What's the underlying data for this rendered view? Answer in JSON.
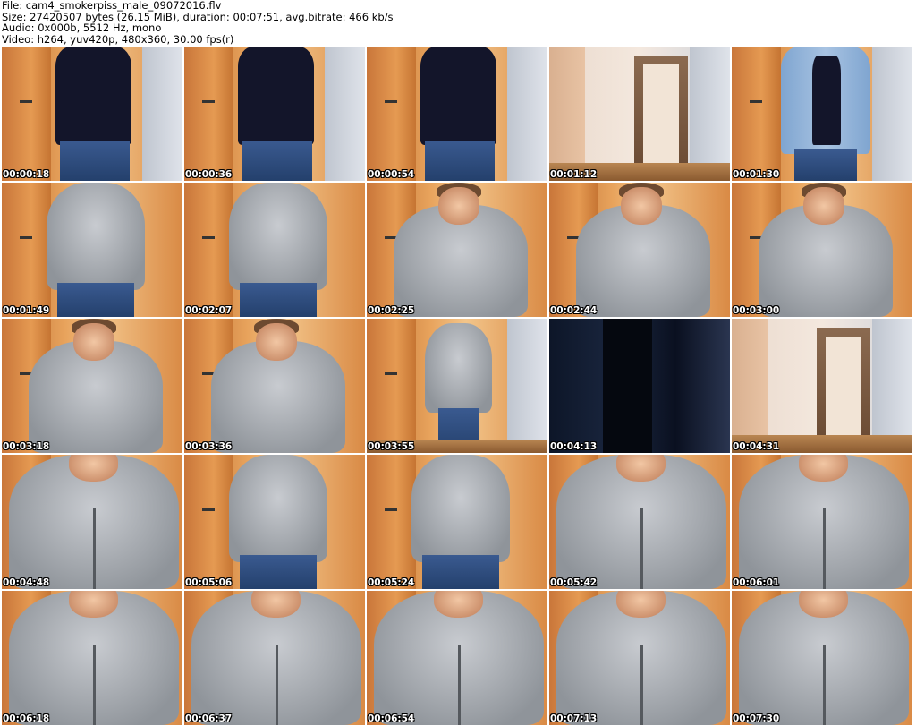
{
  "header": {
    "file": "File: cam4_smokerpiss_male_09072016.flv",
    "size": "Size: 27420507 bytes (26.15 MiB), duration: 00:07:51, avg.bitrate: 466 kb/s",
    "audio": "Audio: 0x000b, 5512 Hz, mono",
    "video": "Video: h264, yuv420p, 480x360, 30.00 fps(r)"
  },
  "thumbnails": [
    {
      "time": "00:00:18",
      "scene": "tank"
    },
    {
      "time": "00:00:36",
      "scene": "tank"
    },
    {
      "time": "00:00:54",
      "scene": "tank"
    },
    {
      "time": "00:01:12",
      "scene": "room"
    },
    {
      "time": "00:01:30",
      "scene": "jacket"
    },
    {
      "time": "00:01:49",
      "scene": "hoodie"
    },
    {
      "time": "00:02:07",
      "scene": "hoodie"
    },
    {
      "time": "00:02:25",
      "scene": "hoodie-face"
    },
    {
      "time": "00:02:44",
      "scene": "hoodie-face"
    },
    {
      "time": "00:03:00",
      "scene": "hoodie-face"
    },
    {
      "time": "00:03:18",
      "scene": "hoodie-face"
    },
    {
      "time": "00:03:36",
      "scene": "hoodie-face"
    },
    {
      "time": "00:03:55",
      "scene": "back"
    },
    {
      "time": "00:04:13",
      "scene": "dark"
    },
    {
      "time": "00:04:31",
      "scene": "room"
    },
    {
      "time": "00:04:48",
      "scene": "hoodie-close"
    },
    {
      "time": "00:05:06",
      "scene": "hoodie"
    },
    {
      "time": "00:05:24",
      "scene": "hoodie"
    },
    {
      "time": "00:05:42",
      "scene": "hoodie-close"
    },
    {
      "time": "00:06:01",
      "scene": "hoodie-close"
    },
    {
      "time": "00:06:18",
      "scene": "hoodie-close"
    },
    {
      "time": "00:06:37",
      "scene": "hoodie-close"
    },
    {
      "time": "00:06:54",
      "scene": "hoodie-close"
    },
    {
      "time": "00:07:13",
      "scene": "hoodie-close"
    },
    {
      "time": "00:07:30",
      "scene": "hoodie-close"
    }
  ]
}
